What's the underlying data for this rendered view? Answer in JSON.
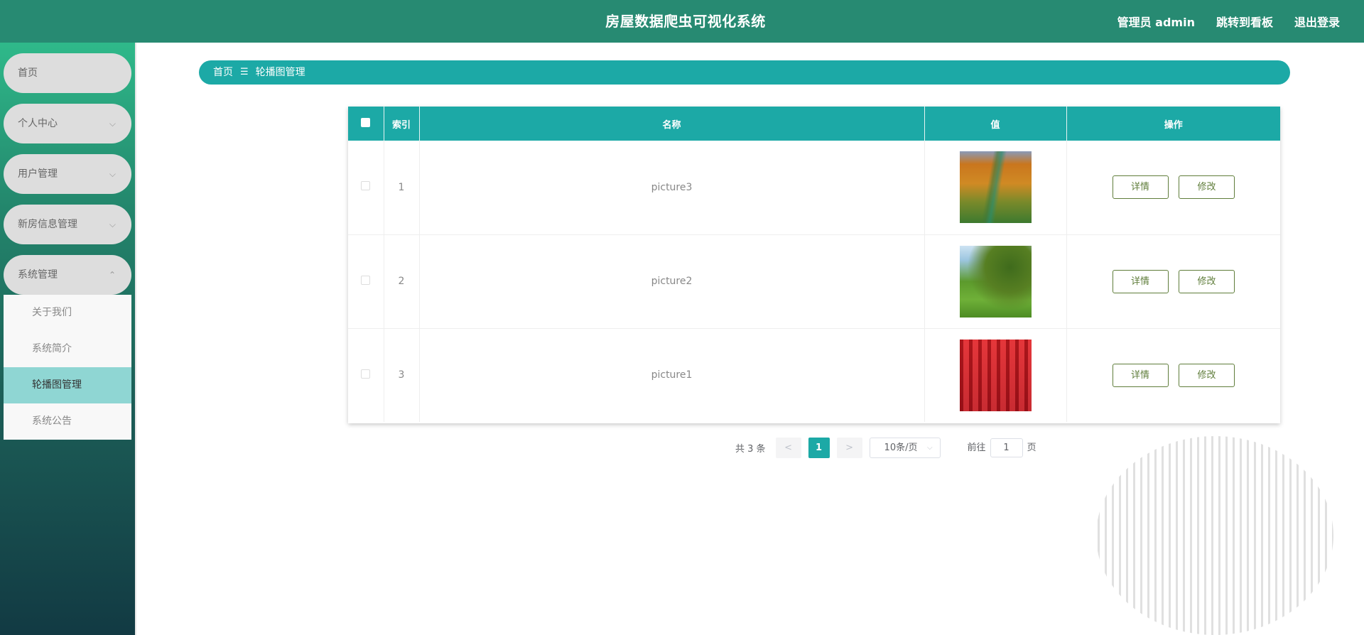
{
  "header": {
    "title": "房屋数据爬虫可视化系统",
    "user": "管理员 admin",
    "dashboard_link": "跳转到看板",
    "logout": "退出登录"
  },
  "sidebar": {
    "items": [
      {
        "label": "首页",
        "chevron": ""
      },
      {
        "label": "个人中心",
        "chevron": "⌵"
      },
      {
        "label": "用户管理",
        "chevron": "⌵"
      },
      {
        "label": "新房信息管理",
        "chevron": "⌵"
      },
      {
        "label": "系统管理",
        "chevron": "⌃"
      }
    ],
    "submenu": [
      {
        "label": "关于我们"
      },
      {
        "label": "系统简介"
      },
      {
        "label": "轮播图管理",
        "active": true
      },
      {
        "label": "系统公告"
      }
    ]
  },
  "breadcrumb": {
    "home": "首页",
    "separator": "☰",
    "current": "轮播图管理"
  },
  "table": {
    "headers": [
      "",
      "索引",
      "名称",
      "值",
      "操作"
    ],
    "rows": [
      {
        "index": "1",
        "name": "picture3",
        "image": "autumn-trees-path"
      },
      {
        "index": "2",
        "name": "picture2",
        "image": "green-willow-lawn"
      },
      {
        "index": "3",
        "name": "picture1",
        "image": "red-tree-avenue"
      }
    ],
    "detail_label": "详情",
    "edit_label": "修改"
  },
  "pagination": {
    "total": "共 3 条",
    "prev": "<",
    "current": "1",
    "next": ">",
    "page_size": "10条/页",
    "goto_prefix": "前往",
    "goto_value": "1",
    "goto_suffix": "页"
  },
  "colors": {
    "header": "#278a72",
    "accent": "#1ca9a6",
    "active_submenu": "#8fd6d3",
    "button_border": "#5f7d3a"
  }
}
